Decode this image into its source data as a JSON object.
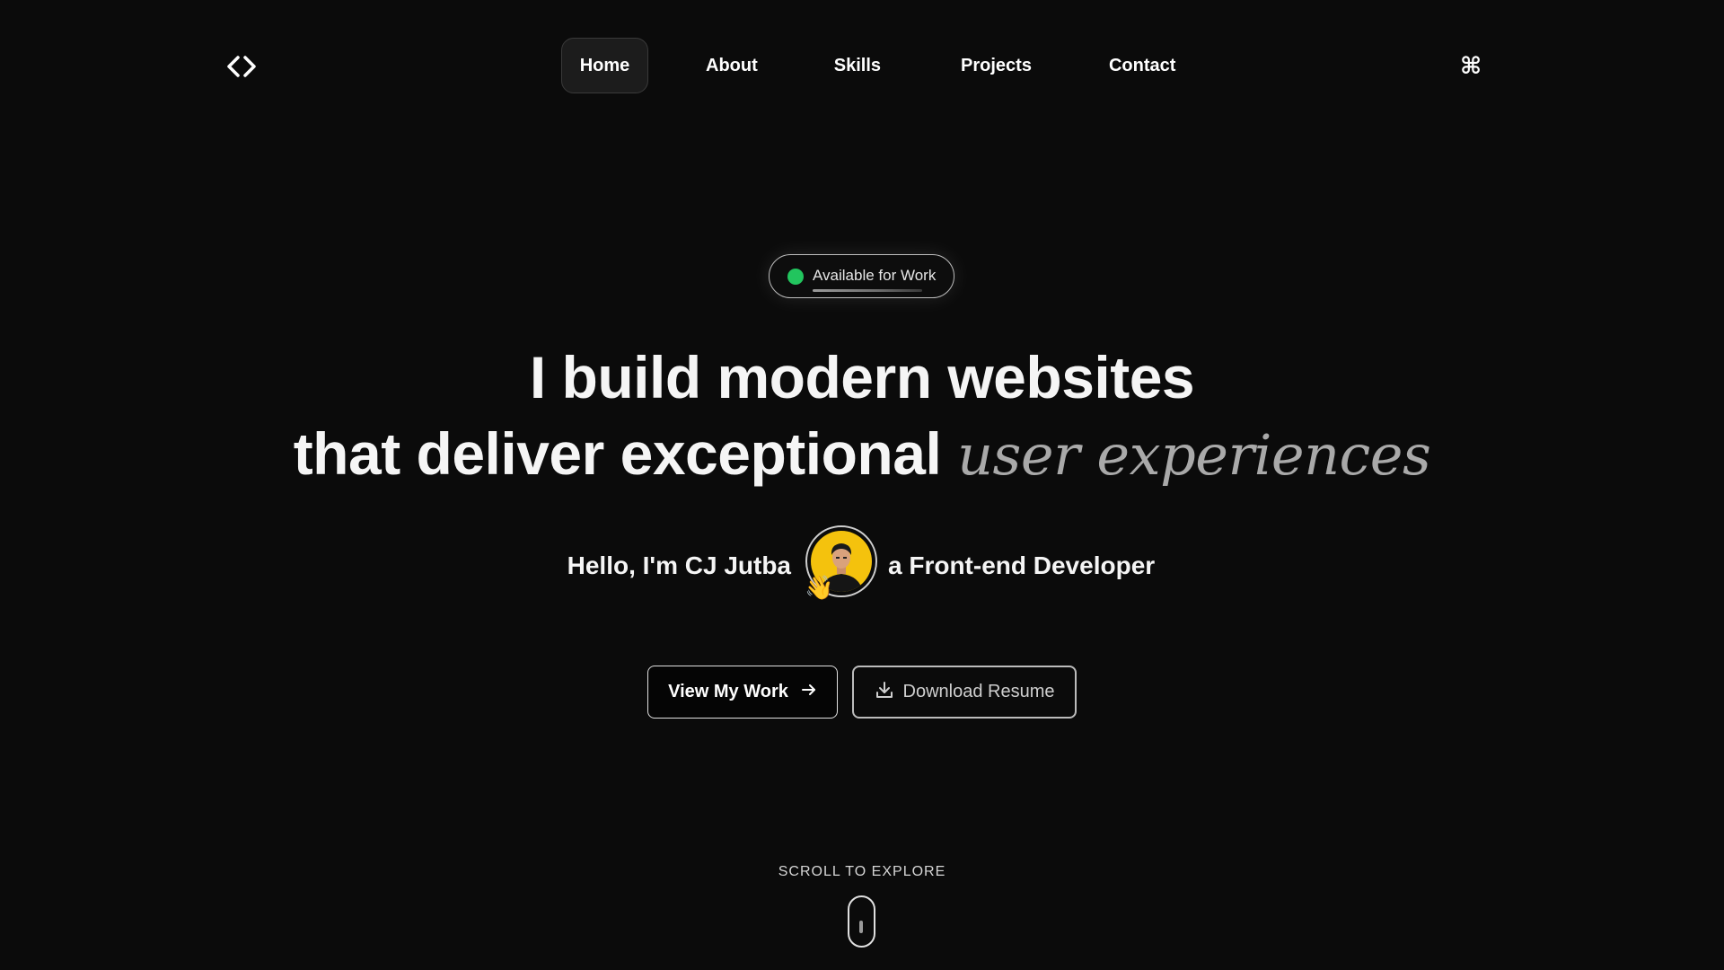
{
  "header": {
    "logo_icon": "code-brackets-icon",
    "nav": [
      {
        "label": "Home",
        "active": true
      },
      {
        "label": "About",
        "active": false
      },
      {
        "label": "Skills",
        "active": false
      },
      {
        "label": "Projects",
        "active": false
      },
      {
        "label": "Contact",
        "active": false
      }
    ],
    "command_symbol": "⌘"
  },
  "hero": {
    "badge": {
      "label": "Available for Work",
      "status_color": "#22c55e"
    },
    "headline": {
      "line1": "I build modern websites",
      "line2": "that deliver exceptional",
      "accent": "user experiences"
    },
    "intro": {
      "greeting": "Hello, I'm CJ Jutba",
      "role": "a Front-end Developer",
      "avatar_icon": "profile-photo",
      "wave_emoji": "👋"
    },
    "buttons": {
      "primary": {
        "label": "View My Work",
        "icon": "arrow-right-icon"
      },
      "secondary": {
        "label": "Download Resume",
        "icon": "download-icon"
      }
    }
  },
  "scroll": {
    "label": "SCROLL TO EXPLORE",
    "icon": "mouse-scroll-icon"
  },
  "colors": {
    "background": "#0b0b0b",
    "text": "#ffffff",
    "accent_text": "#a9a9a9",
    "status_green": "#22c55e",
    "avatar_bg": "#f4c20d"
  }
}
